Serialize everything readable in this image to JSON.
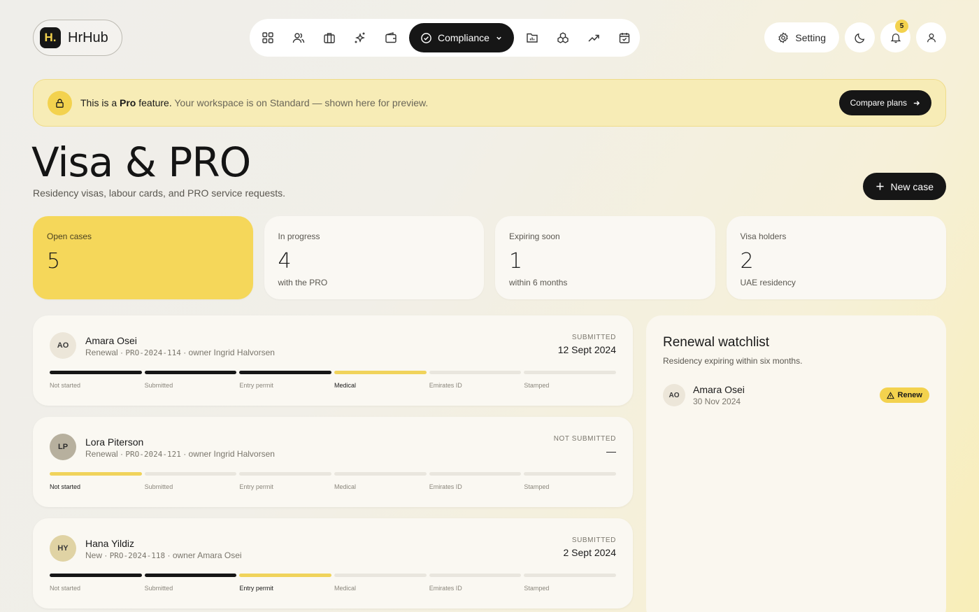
{
  "app": {
    "logo_mark": "H.",
    "logo_text": "HrHub"
  },
  "nav": {
    "icons": [
      "dashboard-icon",
      "people-icon",
      "briefcase-icon",
      "sparkles-icon",
      "wallet-icon",
      "compliance-icon",
      "folder-chart-icon",
      "modules-icon",
      "trend-icon",
      "calendar-icon"
    ],
    "active_label": "Compliance"
  },
  "toolbar": {
    "setting_label": "Setting",
    "notification_count": "5"
  },
  "banner": {
    "text_prefix": "This is a ",
    "text_bold": "Pro",
    "text_feature": " feature.",
    "text_muted": "Your workspace is on Standard — shown here for preview.",
    "button_label": "Compare plans"
  },
  "page": {
    "title": "Visa & PRO",
    "subtitle": "Residency visas, labour cards, and PRO service requests.",
    "new_case_label": "New case"
  },
  "stats": [
    {
      "label": "Open cases",
      "value": "5",
      "note": ""
    },
    {
      "label": "In progress",
      "value": "4",
      "note": "with the PRO"
    },
    {
      "label": "Expiring soon",
      "value": "1",
      "note": "within 6 months"
    },
    {
      "label": "Visa holders",
      "value": "2",
      "note": "UAE residency"
    }
  ],
  "steps": [
    "Not started",
    "Submitted",
    "Entry permit",
    "Medical",
    "Emirates ID",
    "Stamped"
  ],
  "cases": [
    {
      "initials": "AO",
      "name": "Amara Osei",
      "type": "Renewal",
      "ref": "PRO-2024-114",
      "owner": "owner Ingrid Halvorsen",
      "status_label": "SUBMITTED",
      "status_date": "12 Sept 2024",
      "current_step": 3
    },
    {
      "initials": "LP",
      "name": "Lora Piterson",
      "type": "Renewal",
      "ref": "PRO-2024-121",
      "owner": "owner Ingrid Halvorsen",
      "status_label": "NOT SUBMITTED",
      "status_date": "—",
      "current_step": 0
    },
    {
      "initials": "HY",
      "name": "Hana Yildiz",
      "type": "New",
      "ref": "PRO-2024-118",
      "owner": "owner Amara Osei",
      "status_label": "SUBMITTED",
      "status_date": "2 Sept 2024",
      "current_step": 2
    }
  ],
  "watchlist": {
    "title": "Renewal watchlist",
    "subtitle": "Residency expiring within six months.",
    "items": [
      {
        "initials": "AO",
        "name": "Amara Osei",
        "date": "30 Nov 2024",
        "action": "Renew"
      }
    ]
  }
}
